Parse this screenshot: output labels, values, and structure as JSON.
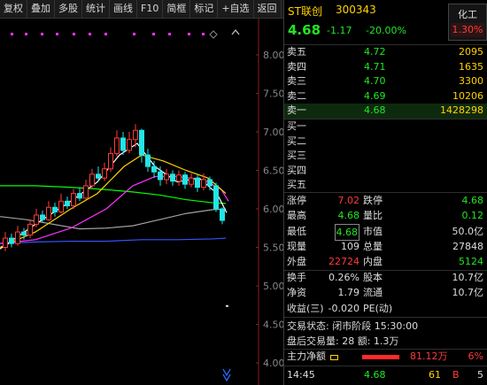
{
  "toolbar": {
    "buttons": [
      "复权",
      "叠加",
      "多股",
      "统计",
      "画线",
      "F10",
      "简框",
      "标记",
      "+自选",
      "返回"
    ]
  },
  "chart": {
    "price_ticks": [
      "8.00",
      "7.50",
      "7.00",
      "6.50",
      "6.00",
      "5.50",
      "5.00",
      "4.50",
      "4.00"
    ],
    "colors": {
      "up": "#ff3b3b",
      "down": "#22e5e5",
      "ma5": "#ffffff",
      "ma10": "#ffd200",
      "ma20": "#ff33ff",
      "ma30": "#00ff00",
      "ma60": "#a0a0a0",
      "ma120": "#3355ff"
    }
  },
  "header": {
    "name": "ST联创",
    "code": "300343",
    "price": "4.68",
    "change": "-1.17",
    "change_pct": "-20.00%",
    "indicator_name": "化工",
    "indicator_value": "1.30%"
  },
  "orderbook": {
    "asks": [
      {
        "label": "卖五",
        "price": "4.72",
        "volume": "2095"
      },
      {
        "label": "卖四",
        "price": "4.71",
        "volume": "1635"
      },
      {
        "label": "卖三",
        "price": "4.70",
        "volume": "3300"
      },
      {
        "label": "卖二",
        "price": "4.69",
        "volume": "10206"
      },
      {
        "label": "卖一",
        "price": "4.68",
        "volume": "1428298"
      }
    ],
    "bids": [
      {
        "label": "买一"
      },
      {
        "label": "买二"
      },
      {
        "label": "买三"
      },
      {
        "label": "买四"
      },
      {
        "label": "买五"
      }
    ]
  },
  "stats": {
    "limit_up_label": "涨停",
    "limit_up": "7.02",
    "limit_down_label": "跌停",
    "limit_down": "4.68",
    "high_label": "最高",
    "high": "4.68",
    "vol_ratio_label": "量比",
    "vol_ratio": "0.12",
    "low_label": "最低",
    "low": "4.68",
    "mkt_value_label": "市值",
    "mkt_value": "50.0亿",
    "cur_vol_label": "现量",
    "cur_vol": "109",
    "total_vol_label": "总量",
    "total_vol": "27848",
    "outer_label": "外盘",
    "outer": "22724",
    "inner_label": "内盘",
    "inner": "5124",
    "turnover_label": "换手",
    "turnover": "0.26%",
    "equity_label": "股本",
    "equity": "10.7亿",
    "nav_label": "净资",
    "nav": "1.79",
    "float_label": "流通",
    "float": "10.7亿",
    "eps_label": "收益(三)",
    "eps": "-0.020",
    "pe_label": "PE(动)",
    "pe": ""
  },
  "info": {
    "trade_status": "交易状态: 闭市阶段 15:30:00",
    "after_hours": "盘后交易量: 28  额: 1.3万"
  },
  "capital": {
    "label": "主力净额",
    "value": "81.12万",
    "pct": "6%"
  },
  "tick": {
    "time": "14:45",
    "price": "4.68",
    "volume": "61",
    "side": "B",
    "count": "5"
  }
}
